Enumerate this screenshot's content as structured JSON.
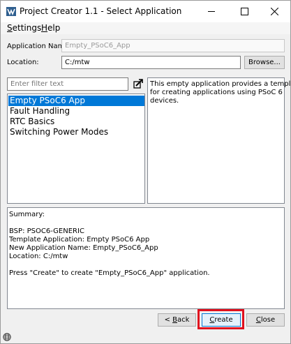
{
  "window": {
    "title": "Project Creator 1.1 - Select Application",
    "minimize_icon": "minimize-icon",
    "maximize_icon": "maximize-icon",
    "close_icon": "close-icon"
  },
  "menu": {
    "settings_first": "S",
    "settings_rest": "ettings",
    "help_first": "H",
    "help_rest": "elp"
  },
  "form": {
    "app_name_label": "Application Name:",
    "app_name_value": "Empty_PSoC6_App",
    "location_label": "Location:",
    "location_value": "C:/mtw",
    "browse_label": "Browse..."
  },
  "filter": {
    "placeholder": "Enter filter text",
    "import_icon": "import-arrow-icon"
  },
  "applications": [
    {
      "label": "Empty PSoC6 App",
      "selected": true
    },
    {
      "label": "Fault Handling",
      "selected": false
    },
    {
      "label": "RTC Basics",
      "selected": false
    },
    {
      "label": "Switching Power Modes",
      "selected": false
    }
  ],
  "description": {
    "lines": [
      "This empty application provides a template",
      "for creating applications using PSoC 6",
      "devices."
    ]
  },
  "summary": {
    "heading": "Summary:",
    "bsp": "BSP: PSOC6-GENERIC",
    "template": "Template Application: Empty PSoC6 App",
    "new_name": "New Application Name: Empty_PSoC6_App",
    "location": "Location: C:/mtw",
    "instruction": "Press \"Create\" to create \"Empty_PSoC6_App\" application."
  },
  "buttons": {
    "back_prefix": "< ",
    "back_first": "B",
    "back_rest": "ack",
    "create_first": "C",
    "create_rest": "reate",
    "close_first": "C",
    "close_rest": "lose"
  },
  "statusbar": {
    "globe_icon": "globe-icon"
  },
  "colors": {
    "selection": "#0078d7",
    "highlight": "#e0101e"
  }
}
